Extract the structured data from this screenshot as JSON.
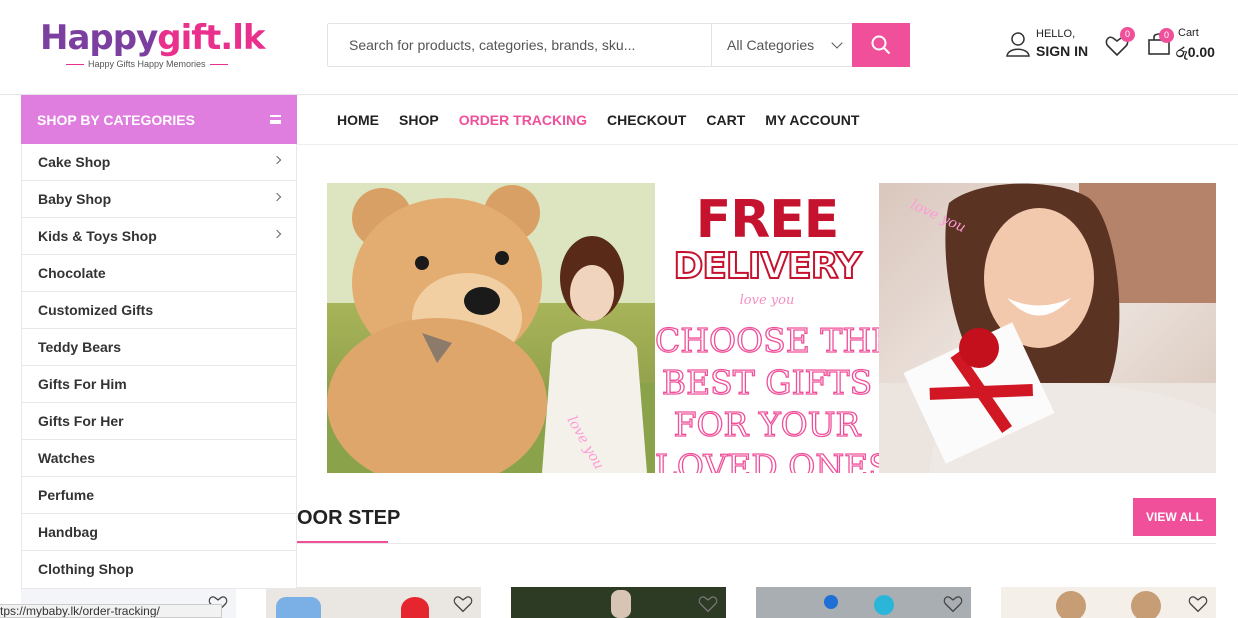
{
  "logo": {
    "part1": "Happy",
    "part2": "gift.lk",
    "tagline": "Happy Gifts Happy Memories"
  },
  "search": {
    "placeholder": "Search for products, categories, brands, sku...",
    "category": "All Categories"
  },
  "account": {
    "greeting": "HELLO,",
    "action": "SIGN IN"
  },
  "wishlist": {
    "count": "0"
  },
  "cart": {
    "label": "Cart",
    "count": "0",
    "amount": "රු0.00"
  },
  "categories": {
    "title": "SHOP BY CATEGORIES",
    "items": [
      {
        "label": "Cake Shop",
        "submenu": true
      },
      {
        "label": "Baby Shop",
        "submenu": true
      },
      {
        "label": "Kids & Toys Shop",
        "submenu": true
      },
      {
        "label": "Chocolate"
      },
      {
        "label": "Customized Gifts"
      },
      {
        "label": "Teddy Bears"
      },
      {
        "label": "Gifts For Him"
      },
      {
        "label": "Gifts For Her"
      },
      {
        "label": "Watches"
      },
      {
        "label": "Perfume"
      },
      {
        "label": "Handbag"
      },
      {
        "label": "Clothing Shop"
      }
    ]
  },
  "nav": {
    "items": [
      "HOME",
      "SHOP",
      "ORDER TRACKING",
      "CHECKOUT",
      "CART",
      "MY ACCOUNT"
    ],
    "active": "ORDER TRACKING"
  },
  "banner": {
    "headline": "FREE",
    "subheadline": "DELIVERY",
    "love_small": "love you",
    "lines": [
      "CHOOSE THE",
      "BEST GIFTS",
      "FOR YOUR",
      "LOVED ONES"
    ],
    "love_left": "love you",
    "love_right": "love you"
  },
  "section": {
    "title_visible": "OOR STEP",
    "view_all": "VIEW ALL"
  },
  "status_bar": {
    "url": "tps://mybaby.lk/order-tracking/"
  },
  "colors": {
    "accent": "#f0509a",
    "category_bar": "#e07ee0",
    "logo_purple": "#7b3fa0",
    "banner_red": "#c4122f"
  }
}
